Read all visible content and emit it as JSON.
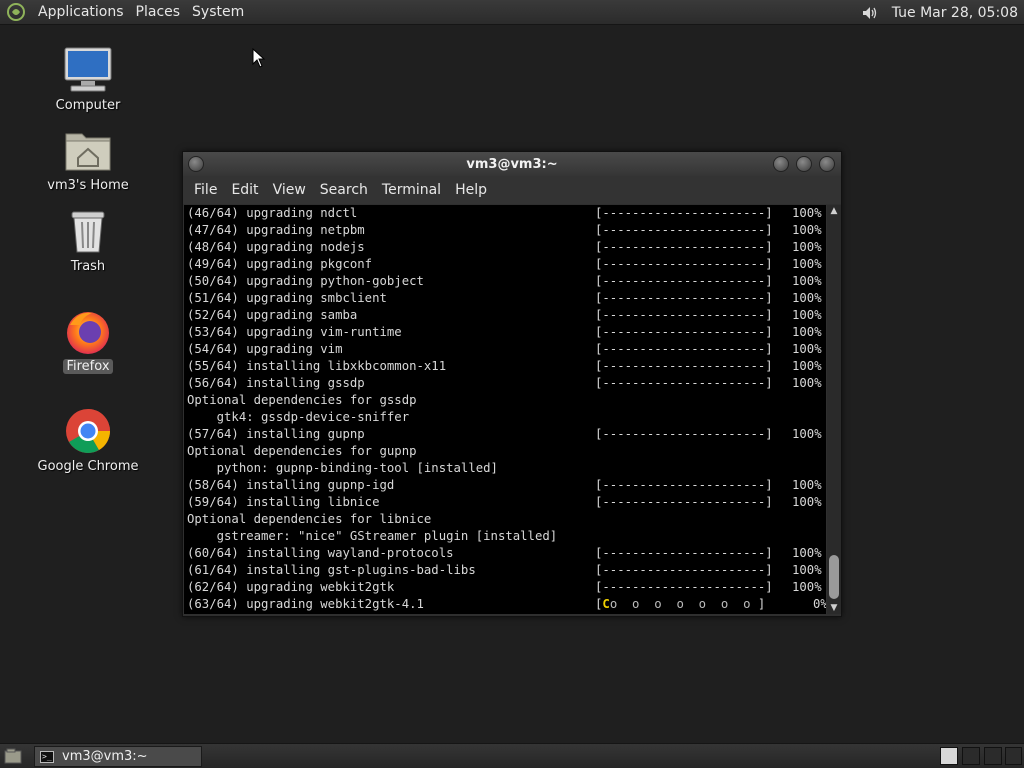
{
  "top_panel": {
    "menus": [
      "Applications",
      "Places",
      "System"
    ],
    "clock": "Tue Mar 28, 05:08"
  },
  "desktop": {
    "icons": [
      {
        "label": "Computer"
      },
      {
        "label": "vm3's Home"
      },
      {
        "label": "Trash"
      },
      {
        "label": "Firefox"
      },
      {
        "label": "Google Chrome"
      }
    ]
  },
  "terminal": {
    "title": "vm3@vm3:~",
    "menus": [
      "File",
      "Edit",
      "View",
      "Search",
      "Terminal",
      "Help"
    ],
    "lines": [
      {
        "text": "(46/64) upgrading ndctl",
        "bar": "[----------------------]",
        "pct": "100%"
      },
      {
        "text": "(47/64) upgrading netpbm",
        "bar": "[----------------------]",
        "pct": "100%"
      },
      {
        "text": "(48/64) upgrading nodejs",
        "bar": "[----------------------]",
        "pct": "100%"
      },
      {
        "text": "(49/64) upgrading pkgconf",
        "bar": "[----------------------]",
        "pct": "100%"
      },
      {
        "text": "(50/64) upgrading python-gobject",
        "bar": "[----------------------]",
        "pct": "100%"
      },
      {
        "text": "(51/64) upgrading smbclient",
        "bar": "[----------------------]",
        "pct": "100%"
      },
      {
        "text": "(52/64) upgrading samba",
        "bar": "[----------------------]",
        "pct": "100%"
      },
      {
        "text": "(53/64) upgrading vim-runtime",
        "bar": "[----------------------]",
        "pct": "100%"
      },
      {
        "text": "(54/64) upgrading vim",
        "bar": "[----------------------]",
        "pct": "100%"
      },
      {
        "text": "(55/64) installing libxkbcommon-x11",
        "bar": "[----------------------]",
        "pct": "100%"
      },
      {
        "text": "(56/64) installing gssdp",
        "bar": "[----------------------]",
        "pct": "100%"
      },
      {
        "text": "Optional dependencies for gssdp",
        "bar": "",
        "pct": ""
      },
      {
        "text": "    gtk4: gssdp-device-sniffer",
        "bar": "",
        "pct": ""
      },
      {
        "text": "(57/64) installing gupnp",
        "bar": "[----------------------]",
        "pct": "100%"
      },
      {
        "text": "Optional dependencies for gupnp",
        "bar": "",
        "pct": ""
      },
      {
        "text": "    python: gupnp-binding-tool [installed]",
        "bar": "",
        "pct": ""
      },
      {
        "text": "(58/64) installing gupnp-igd",
        "bar": "[----------------------]",
        "pct": "100%"
      },
      {
        "text": "(59/64) installing libnice",
        "bar": "[----------------------]",
        "pct": "100%"
      },
      {
        "text": "Optional dependencies for libnice",
        "bar": "",
        "pct": ""
      },
      {
        "text": "    gstreamer: \"nice\" GStreamer plugin [installed]",
        "bar": "",
        "pct": ""
      },
      {
        "text": "(60/64) installing wayland-protocols",
        "bar": "[----------------------]",
        "pct": "100%"
      },
      {
        "text": "(61/64) installing gst-plugins-bad-libs",
        "bar": "[----------------------]",
        "pct": "100%"
      },
      {
        "text": "(62/64) upgrading webkit2gtk",
        "bar": "[----------------------]",
        "pct": "100%"
      },
      {
        "text": "(63/64) upgrading webkit2gtk-4.1",
        "bar": "",
        "pct": "0%",
        "pacman": true
      }
    ],
    "pacman_bar": {
      "open": "[",
      "head": "C",
      "dots": "o  o  o  o  o  o  o",
      "close": " ]",
      "progress": 0
    }
  },
  "taskbar": {
    "task_label": "vm3@vm3:~"
  },
  "colors": {
    "desktop_bg": "#1f1f1f",
    "terminal_bg": "#000000",
    "terminal_fg": "#d8d8d8",
    "pacman_head": "#f0d000"
  }
}
